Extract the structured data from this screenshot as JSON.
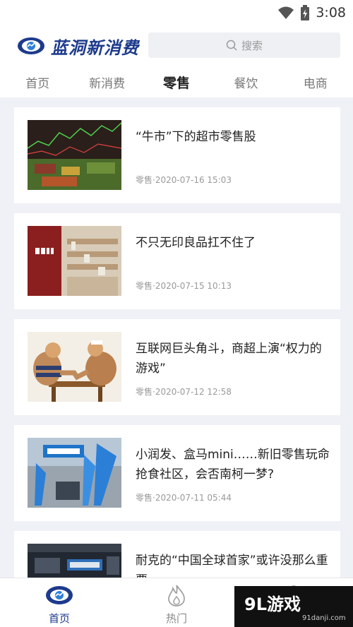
{
  "status_bar": {
    "time": "3:08",
    "icons": [
      "wifi-icon",
      "battery-icon"
    ]
  },
  "header": {
    "logo_text": "蓝洞新消费",
    "search_placeholder": "搜索"
  },
  "tabs": [
    {
      "label": "首页",
      "active": false
    },
    {
      "label": "新消费",
      "active": false
    },
    {
      "label": "零售",
      "active": true
    },
    {
      "label": "餐饮",
      "active": false
    },
    {
      "label": "电商",
      "active": false
    }
  ],
  "articles": [
    {
      "title": "“牛市”下的超市零售股",
      "category": "零售",
      "date": "2020-07-16 15:03",
      "thumb": "stock-market-produce"
    },
    {
      "title": "不只无印良品扛不住了",
      "category": "零售",
      "date": "2020-07-15 10:13",
      "thumb": "muji-store"
    },
    {
      "title": "互联网巨头角斗，商超上演“权力的游戏”",
      "category": "零售",
      "date": "2020-07-12 12:58",
      "thumb": "arm-wrestling"
    },
    {
      "title": "小润发、盒马mini……新旧零售玩命抢食社区，会否南柯一梦?",
      "category": "零售",
      "date": "2020-07-11 05:44",
      "thumb": "hema-store"
    },
    {
      "title": "耐克的“中国全球首家”或许没那么重要",
      "category": "",
      "date": "",
      "thumb": "nike-store"
    }
  ],
  "meta_separator": "·",
  "bottom_nav": [
    {
      "label": "首页",
      "icon": "eye-logo-icon",
      "active": true
    },
    {
      "label": "热门",
      "icon": "flame-icon",
      "active": false
    },
    {
      "label": "",
      "icon": "user-icon",
      "active": false
    }
  ],
  "watermark": {
    "brand": "9L游戏",
    "url": "91danji.com"
  },
  "colors": {
    "brand": "#1d3a8c",
    "background": "#f0f1f6",
    "muted": "#9a9a9a"
  }
}
